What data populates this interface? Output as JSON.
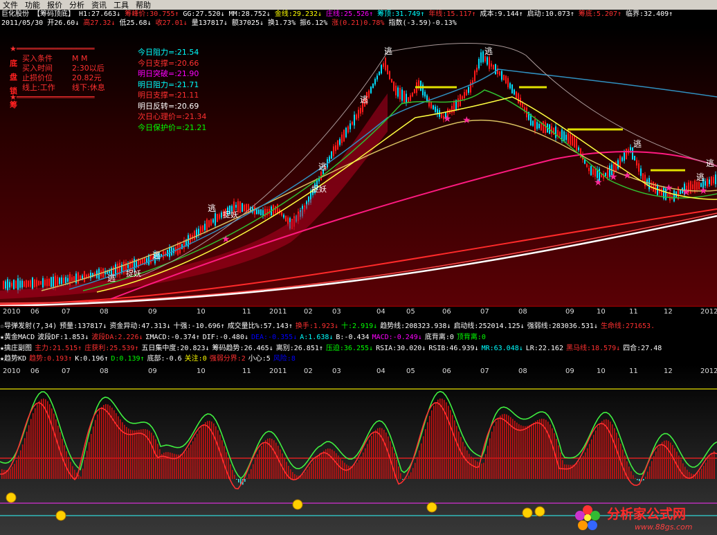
{
  "toolbar": {
    "items": [
      "文件",
      "功能",
      "报价",
      "分析",
      "资讯",
      "工具",
      "帮助"
    ]
  },
  "stock": {
    "line1": [
      {
        "t": "巨化股份",
        "c": "#ffffff"
      },
      {
        "t": "【筹码顶底】",
        "c": "#ffffff"
      },
      {
        "t": "H1:27.663↓",
        "c": "#ffffff"
      },
      {
        "t": "筹峰价:30.755↑",
        "c": "#ff3030"
      },
      {
        "t": "GG:27.520↓",
        "c": "#ffffff"
      },
      {
        "t": "MM:28.752↓",
        "c": "#ffffff"
      },
      {
        "t": "金线:29.232↓",
        "c": "#ffff00"
      },
      {
        "t": "庄线:25.526↑",
        "c": "#ff00ff"
      },
      {
        "t": "筹顶:31.749↑",
        "c": "#00ffff"
      },
      {
        "t": "年线:15.117↑",
        "c": "#ff3030"
      },
      {
        "t": "成本:9.144↑",
        "c": "#ffffff"
      },
      {
        "t": "启动:10.073↑",
        "c": "#ffffff"
      },
      {
        "t": "筹底:5.207↑",
        "c": "#ff3030"
      },
      {
        "t": "临界:32.409↑",
        "c": "#ffffff"
      }
    ],
    "line2": [
      {
        "t": "2011/05/30",
        "c": "#ffffff"
      },
      {
        "t": "开26.60↓",
        "c": "#ffffff"
      },
      {
        "t": "高27.32↓",
        "c": "#ff3030"
      },
      {
        "t": "低25.68↓",
        "c": "#ffffff"
      },
      {
        "t": "收27.01↓",
        "c": "#ff3030"
      },
      {
        "t": "量137817↓",
        "c": "#ffffff"
      },
      {
        "t": "额37025↓",
        "c": "#ffffff"
      },
      {
        "t": "换1.73%",
        "c": "#ffffff"
      },
      {
        "t": "振6.12%",
        "c": "#ffffff"
      },
      {
        "t": "涨(0.21)0.78%",
        "c": "#ff3030"
      },
      {
        "t": "指数(-3.59)-0.13%",
        "c": "#ffffff"
      }
    ]
  },
  "info": {
    "rows": [
      {
        "a": "★═════════════════",
        "b": ""
      },
      {
        "a": "买入条件",
        "b": "M M"
      },
      {
        "a": "买入时间",
        "b": "2:30以后"
      },
      {
        "a": "止损价位",
        "b": "20.82元"
      },
      {
        "a": "线上:工作",
        "b": "线下:休息"
      },
      {
        "a": "★═════════════════",
        "b": ""
      }
    ],
    "side": [
      "底",
      "盘",
      "锁",
      "筹"
    ]
  },
  "levels": [
    {
      "t": "今日阻力=:21.54",
      "c": "#00ffff"
    },
    {
      "t": "今日支撑=:20.66",
      "c": "#ff3030"
    },
    {
      "t": "明日突破=:21.90",
      "c": "#ff00ff"
    },
    {
      "t": "明日阻力=:21.71",
      "c": "#00ffff"
    },
    {
      "t": "明日支撑=:21.11",
      "c": "#ff3030"
    },
    {
      "t": "明日反转=:20.69",
      "c": "#ffffff"
    },
    {
      "t": "次日心理价=:21.34",
      "c": "#ff3030"
    },
    {
      "t": "今日保护价=:21.21",
      "c": "#00ff00"
    }
  ],
  "annotations": {
    "escape": "逃",
    "demon": "捉妖"
  },
  "months": [
    "2010",
    "06",
    "07",
    "08",
    "09",
    "10",
    "11",
    "2011",
    "02",
    "03",
    "04",
    "05",
    "06",
    "07",
    "08",
    "09",
    "10",
    "11",
    "12",
    "2012"
  ],
  "sub_months": [
    "2010",
    "06",
    "07",
    "08",
    "09",
    "10",
    "11",
    "2011",
    "02",
    "03",
    "04",
    "05",
    "06",
    "07",
    "08",
    "09",
    "10",
    "11",
    "12",
    "2012"
  ],
  "indicators": [
    [
      {
        "t": "☆导弹发射(7,34)",
        "c": "#ffffff"
      },
      {
        "t": "预量:137817↓",
        "c": "#ffffff"
      },
      {
        "t": "资金异动:47.313↓",
        "c": "#ffffff"
      },
      {
        "t": "十强:-10.696↑",
        "c": "#ffffff"
      },
      {
        "t": "成交量比%:57.143↑",
        "c": "#ffffff"
      },
      {
        "t": "换手:1.923↓",
        "c": "#ff3030"
      },
      {
        "t": "十:2.919↓",
        "c": "#00ff00"
      },
      {
        "t": "趋势线:208323.938↓",
        "c": "#ffffff"
      },
      {
        "t": "启动线:252014.125↓",
        "c": "#ffffff"
      },
      {
        "t": "强弱线:283036.531↓",
        "c": "#ffffff"
      },
      {
        "t": "生命线:271653.",
        "c": "#ff3030"
      }
    ],
    [
      {
        "t": "★黄金MACD",
        "c": "#ffffff"
      },
      {
        "t": "波段DF:1.853↓",
        "c": "#ffffff"
      },
      {
        "t": "波段DA:2.226↓",
        "c": "#ff3030"
      },
      {
        "t": "ΣMACD:-0.374↑",
        "c": "#ffffff"
      },
      {
        "t": "DIF:-0.480↓",
        "c": "#ffffff"
      },
      {
        "t": "DEA:-0.355↓",
        "c": "#0000ff"
      },
      {
        "t": "A:1.638↓",
        "c": "#00ffff"
      },
      {
        "t": "B:-0.434",
        "c": "#ffffff"
      },
      {
        "t": "MACD:-0.249↓",
        "c": "#ff00ff"
      },
      {
        "t": "底背离:0",
        "c": "#ffffff"
      },
      {
        "t": "顶背离:0",
        "c": "#00ff00"
      }
    ],
    [
      {
        "t": "★擒庄副图",
        "c": "#ffffff"
      },
      {
        "t": "主力:21.515↑",
        "c": "#ff3030"
      },
      {
        "t": "庄获利:25.539↑",
        "c": "#ff3030"
      },
      {
        "t": "五日集中度:20.823↓",
        "c": "#ffffff"
      },
      {
        "t": "筹码趋势:26.465↓",
        "c": "#ffffff"
      },
      {
        "t": "离别:26.851↑",
        "c": "#ffffff"
      },
      {
        "t": "压迫:36.255↓",
        "c": "#00ff00"
      },
      {
        "t": "RSIA:30.020↓",
        "c": "#ffffff"
      },
      {
        "t": "RSIB:46.939↓",
        "c": "#ffffff"
      },
      {
        "t": "MR:63.048↓",
        "c": "#00ffff"
      },
      {
        "t": "LR:22.162",
        "c": "#ffffff"
      },
      {
        "t": "黑马线:18.579↓",
        "c": "#ff3030"
      },
      {
        "t": "四合:27.48",
        "c": "#ffffff"
      }
    ],
    [
      {
        "t": "★趋势KD",
        "c": "#ffffff"
      },
      {
        "t": "趋势:0.193↑",
        "c": "#ff3030"
      },
      {
        "t": "K:0.196↑",
        "c": "#ffffff"
      },
      {
        "t": "D:0.139↑",
        "c": "#00ff00"
      },
      {
        "t": "底部:-0.6",
        "c": "#ffffff"
      },
      {
        "t": "关注:0",
        "c": "#ffff00"
      },
      {
        "t": "强弱分界:2",
        "c": "#ff3030"
      },
      {
        "t": "小心:5",
        "c": "#ffffff"
      },
      {
        "t": "风险:8",
        "c": "#0000ff"
      }
    ]
  ],
  "logo": {
    "name": "分析家公式网",
    "url": "www.88gs.com"
  },
  "colors": {
    "up": "#ff1a1a",
    "down": "#00e0ff",
    "green_line": "#20d020",
    "red_line": "#ff2020",
    "yellow": "#ffff00"
  }
}
